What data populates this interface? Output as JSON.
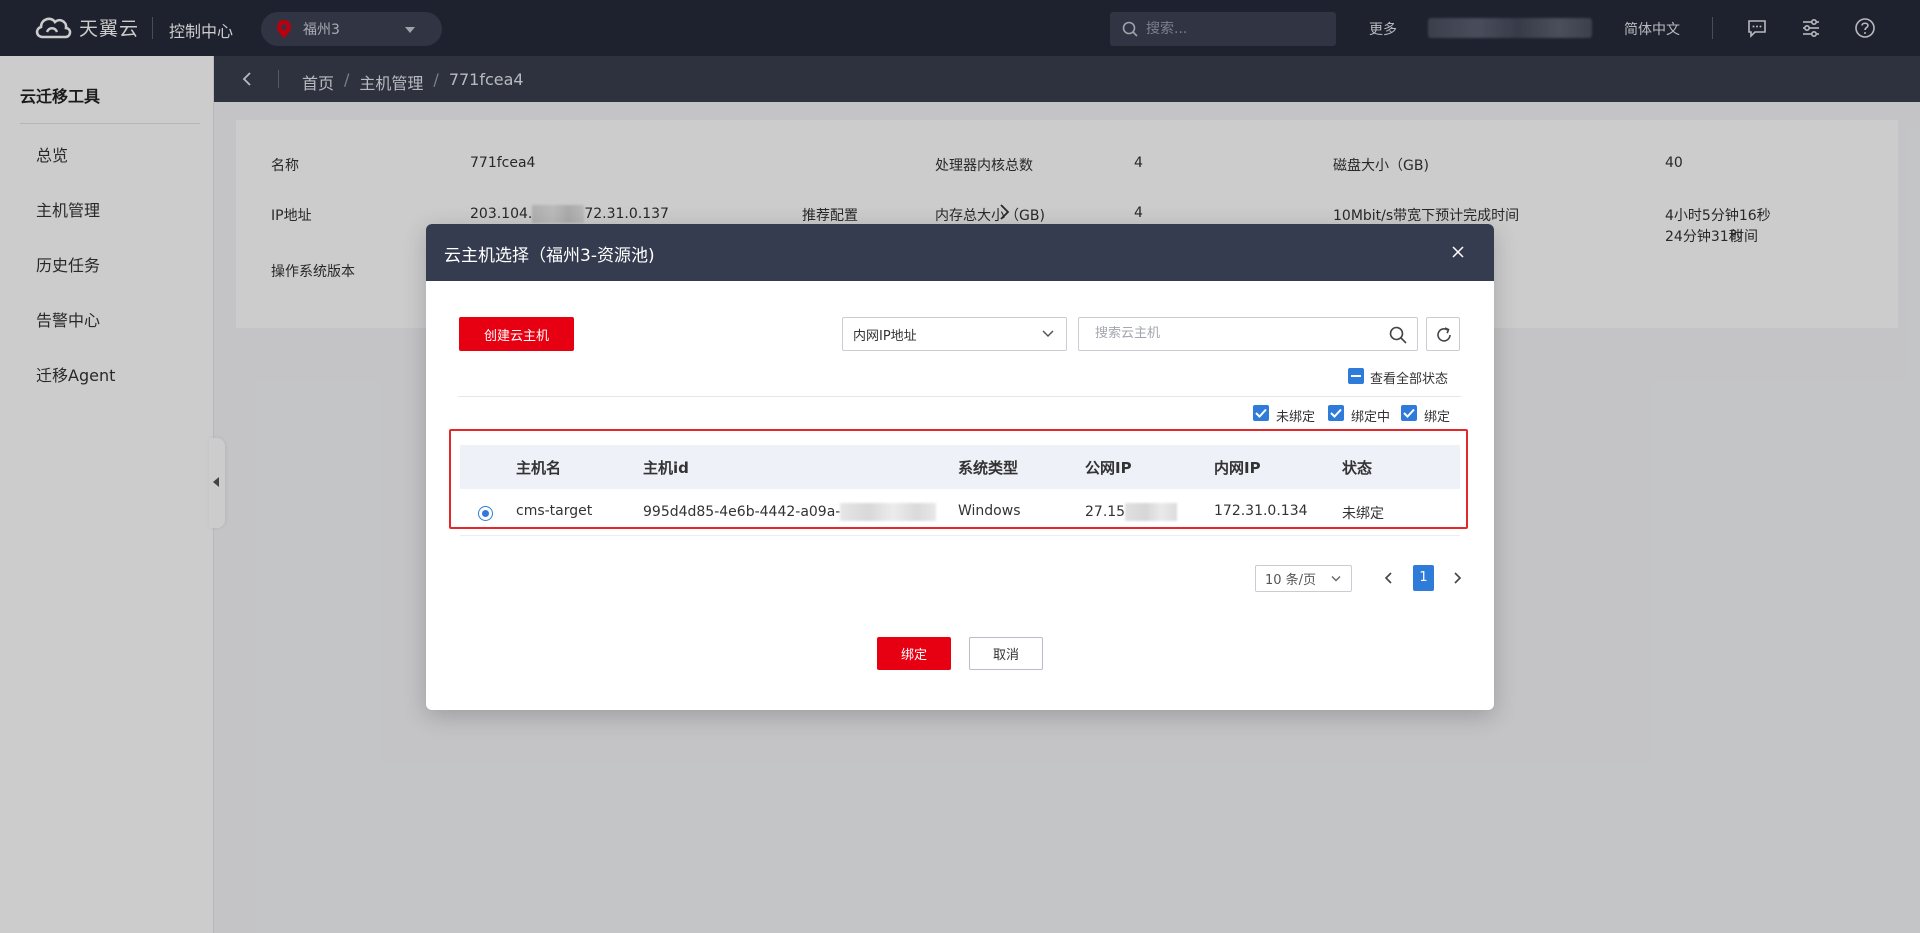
{
  "header": {
    "logo_text": "天翼云",
    "console_label": "控制中心",
    "region": "福州3",
    "search_placeholder": "搜索...",
    "more_label": "更多",
    "language_label": "简体中文",
    "icons": [
      "message-icon",
      "settings-sliders-icon",
      "help-icon"
    ]
  },
  "sidebar": {
    "title": "云迁移工具",
    "items": [
      {
        "label": "总览"
      },
      {
        "label": "主机管理"
      },
      {
        "label": "历史任务"
      },
      {
        "label": "告警中心"
      },
      {
        "label": "迁移Agent"
      }
    ]
  },
  "breadcrumb": {
    "items": [
      "首页",
      "主机管理",
      "771fcea4"
    ]
  },
  "host_info": {
    "name_label": "名称",
    "name_value": "771fcea4",
    "ip_label": "IP地址",
    "ip_value_prefix": "203.104.",
    "ip_value_suffix": "72.31.0.137",
    "os_label": "操作系统版本",
    "recommend_label": "推荐配置",
    "cpu_label": "处理器内核总数",
    "cpu_value": "4",
    "mem_label": "内存总大小（GB)",
    "mem_value": "4",
    "disk_label": "磁盘大小（GB)",
    "disk_value": "40",
    "time10_label": "10Mbit/s带宽下预计完成时间",
    "time10_value": "4小时5分钟16秒",
    "time_partial_label": "时间",
    "time_partial_value": "24分钟31秒"
  },
  "modal": {
    "title": "云主机选择（福州3-资源池)",
    "create_button": "创建云主机",
    "filter_select": "内网IP地址",
    "search_placeholder": "搜索云主机",
    "view_all_label": "查看全部状态",
    "status_filters": [
      {
        "label": "未绑定",
        "checked": true
      },
      {
        "label": "绑定中",
        "checked": true
      },
      {
        "label": "绑定",
        "checked": true
      }
    ],
    "table": {
      "columns": [
        "主机名",
        "主机id",
        "系统类型",
        "公网IP",
        "内网IP",
        "状态"
      ],
      "rows": [
        {
          "selected": true,
          "hostname": "cms-target",
          "host_id": "995d4d85-4e6b-4442-a09a-",
          "os_type": "Windows",
          "public_ip": "27.15",
          "private_ip": "172.31.0.134",
          "status": "未绑定"
        }
      ]
    },
    "pagination": {
      "page_size": "10 条/页",
      "current_page": "1"
    },
    "confirm_button": "绑定",
    "cancel_button": "取消"
  },
  "colors": {
    "brand_red": "#e60012",
    "accent_blue": "#2f7bd9",
    "header_bg": "#262b3a",
    "highlight_frame": "#e32929"
  }
}
